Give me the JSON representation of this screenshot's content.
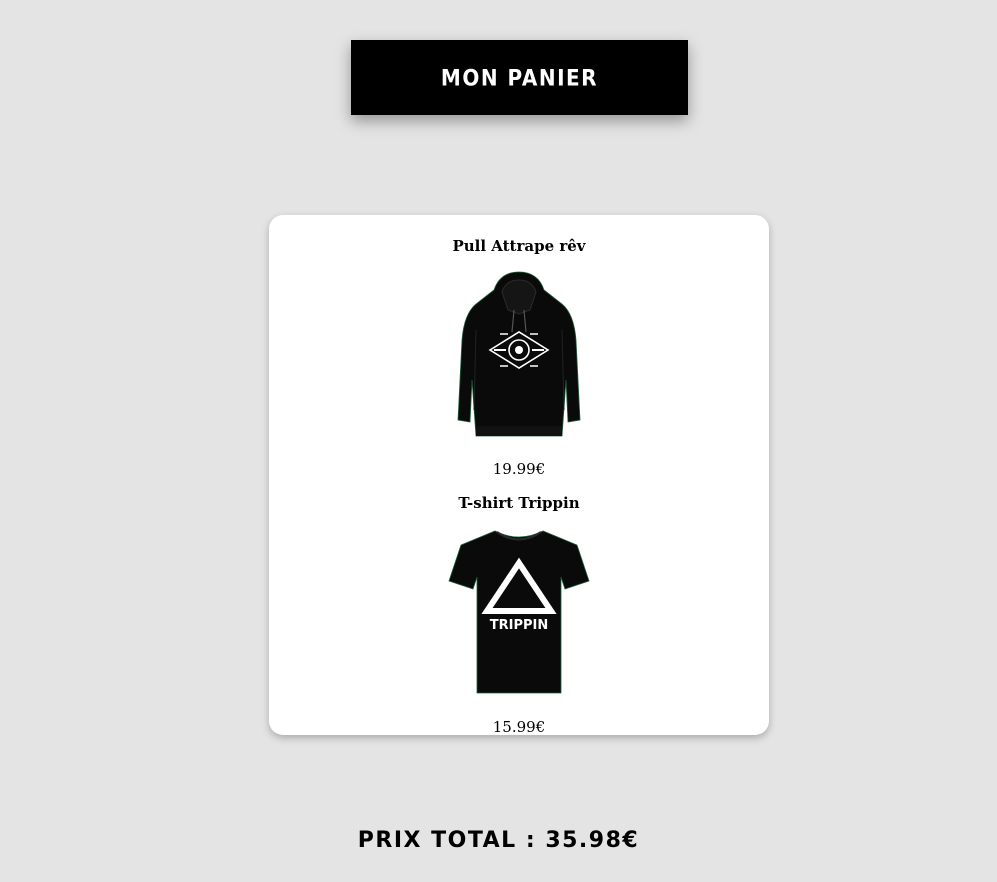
{
  "header": {
    "title": "MON PANIER"
  },
  "cart": {
    "items": [
      {
        "name": "Pull Attrape rêv",
        "price": "19.99€",
        "image_icon": "hoodie-icon",
        "graphic_icon": "dreamcatcher-emblem-icon"
      },
      {
        "name": "T-shirt Trippin",
        "price": "15.99€",
        "image_icon": "tshirt-icon",
        "graphic_text": "TRIPPIN"
      }
    ]
  },
  "total": {
    "label": "PRIX TOTAL : 35.98€"
  },
  "colors": {
    "background": "#e4e4e4",
    "header_bg": "#000000",
    "card_bg": "#ffffff",
    "garment": "#0a0a0a"
  }
}
